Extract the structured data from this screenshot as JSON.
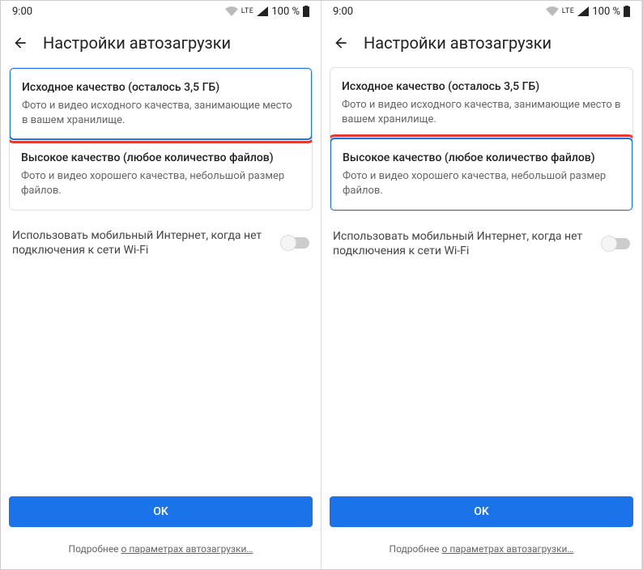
{
  "status": {
    "time": "9:00",
    "lte": "LTE",
    "battery": "100 %"
  },
  "header": {
    "title": "Настройки автозагрузки"
  },
  "options": {
    "original": {
      "title": "Исходное качество (осталось 3,5 ГБ)",
      "desc": "Фото и видео исходного качества, занимающие место в вашем хранилище."
    },
    "high": {
      "title": "Высокое качество (любое количество файлов)",
      "desc": "Фото и видео хорошего качества, небольшой размер файлов."
    }
  },
  "toggle": {
    "label": "Использовать мобильный Интернет, когда нет подключения к сети Wi-Fi"
  },
  "ok": "OK",
  "footer": {
    "prefix": "Подробнее ",
    "link": "о параметрах автозагрузки…"
  }
}
